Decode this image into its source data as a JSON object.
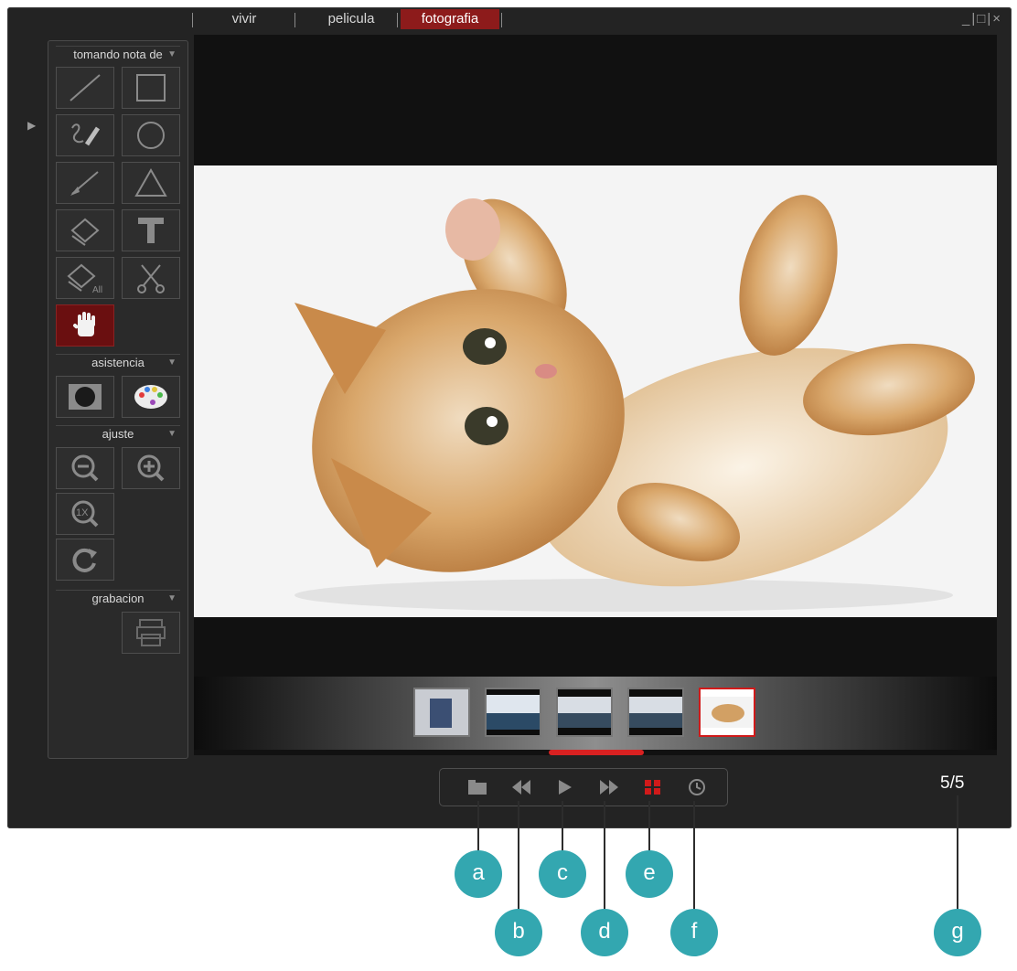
{
  "tabs": [
    "vivir",
    "pelicula",
    "fotografia"
  ],
  "active_tab": "fotografia",
  "window_controls": "_|□|×",
  "sidebar": {
    "sections": {
      "notes": "tomando nota de",
      "assist": "asistencia",
      "adjust": "ajuste",
      "record": "grabacion"
    },
    "tools": [
      "line-tool",
      "rectangle-tool",
      "freehand-tool",
      "circle-tool",
      "arrow-tool",
      "triangle-tool",
      "eraser-tool",
      "text-tool",
      "erase-all-tool",
      "cut-tool",
      "hand-tool"
    ],
    "eraser_all_label": "All",
    "assist_tools": [
      "spotlight-tool",
      "palette-tool"
    ],
    "adjust_tools": [
      "zoom-out-tool",
      "zoom-in-tool",
      "actual-size-tool",
      "rotate-tool"
    ],
    "actual_size_label": "1X",
    "record_tools": [
      "printer-tool"
    ]
  },
  "filmstrip": {
    "thumbnails": 5,
    "active_index": 5
  },
  "playback": {
    "buttons": [
      "folder-icon",
      "rewind-icon",
      "play-icon",
      "fast-forward-icon",
      "grid-icon",
      "timer-icon"
    ]
  },
  "counter": "5/5",
  "callouts": [
    "a",
    "b",
    "c",
    "d",
    "e",
    "f",
    "g"
  ],
  "colors": {
    "accent_red": "#d11a1a",
    "callout_teal": "#33a7b0",
    "window_bg": "#232323"
  }
}
